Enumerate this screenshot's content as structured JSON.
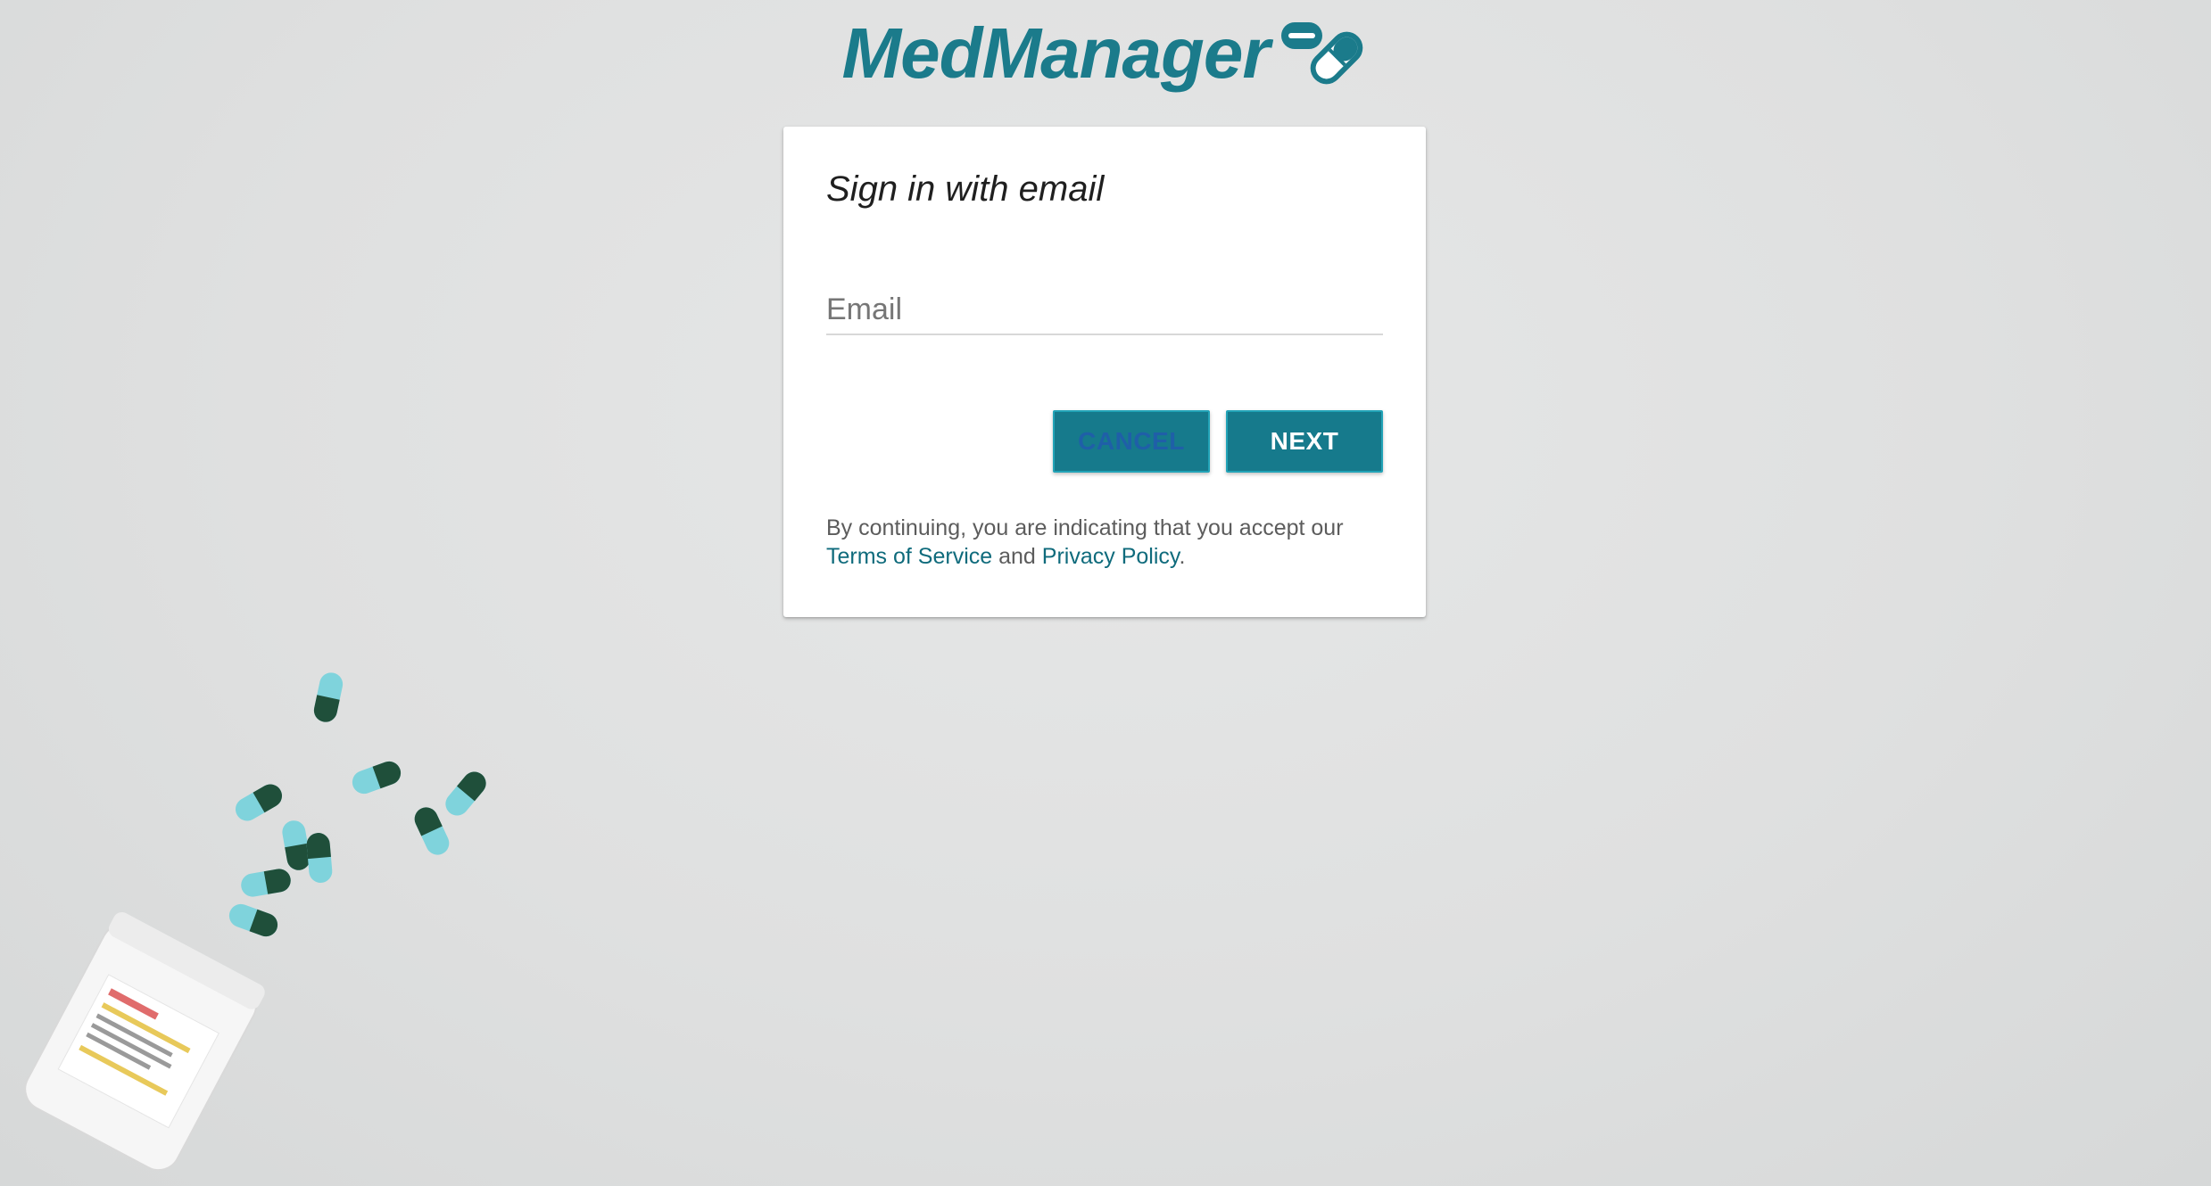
{
  "logo": {
    "text": "MedManager",
    "icon": "pill-capsule-icon",
    "color": "#1b7b8b"
  },
  "signin": {
    "title": "Sign in with email",
    "email_placeholder": "Email",
    "email_value": "",
    "cancel_label": "CANCEL",
    "next_label": "NEXT"
  },
  "legal": {
    "prefix": "By continuing, you are indicating that you accept our",
    "terms_label": "Terms of Service",
    "conjunction": "and",
    "privacy_label": "Privacy Policy",
    "suffix": "."
  },
  "background": {
    "decor": "spilled-pills-bottle-illustration"
  },
  "colors": {
    "accent": "#167a8c",
    "button_border": "#22a3b7",
    "link": "#0f6b7c"
  }
}
